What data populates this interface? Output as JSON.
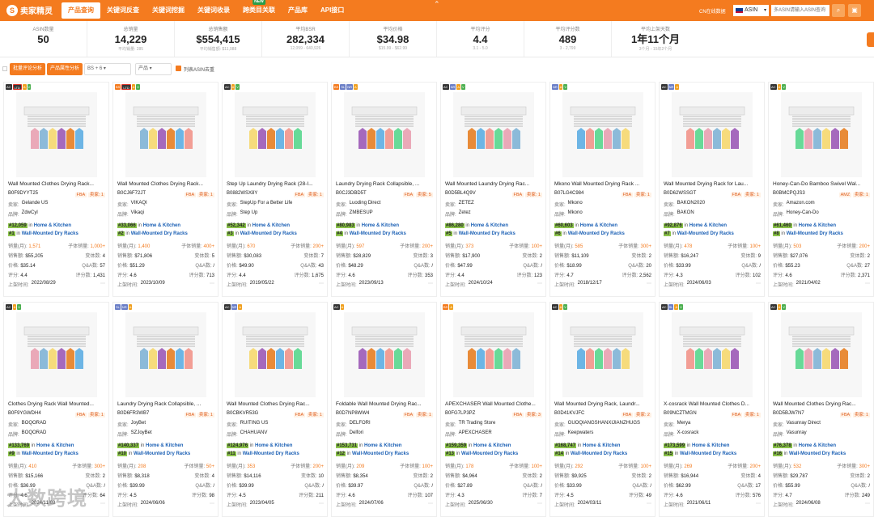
{
  "app": {
    "logo_text": "卖家精灵",
    "status_text": "CN在线数据",
    "marketplace": "ASIN",
    "search_placeholder": "多ASIN请输入ASIN查询"
  },
  "colors": {
    "brand": "#f47b1f",
    "rank_highlight": "#8bc34a",
    "link": "#1a5fb4"
  },
  "nav": [
    {
      "label": "产品查询",
      "active": true
    },
    {
      "label": "关键词反查"
    },
    {
      "label": "关键词挖掘"
    },
    {
      "label": "关键词收录"
    },
    {
      "label": "跨类目关联",
      "badge": "NEW"
    },
    {
      "label": "产品库"
    },
    {
      "label": "API接口"
    }
  ],
  "stats": [
    {
      "label": "ASIN数量",
      "value": "50",
      "sub": ""
    },
    {
      "label": "总销量",
      "value": "14,229",
      "sub": "平均销量: 285"
    },
    {
      "label": "总销售额",
      "value": "$554,415",
      "sub": "平均销售额: $11,088"
    },
    {
      "label": "平均BSR",
      "value": "282,334",
      "sub": "12,059 - 640,926"
    },
    {
      "label": "平均价格",
      "value": "$34.98",
      "sub": "$15.99 - $62.99"
    },
    {
      "label": "平均评分",
      "value": "4.4",
      "sub": "3.1 - 5.0"
    },
    {
      "label": "平均评分数",
      "value": "489",
      "sub": "3 - 2,799"
    },
    {
      "label": "平均上架天数",
      "value": "1年11个月",
      "sub": "3个月 - 15年2个月"
    }
  ],
  "toolbar": {
    "btn1": "批量评论分析",
    "btn2": "产品属性分析",
    "select1": "BS",
    "select1_extra": "+ 6",
    "select2": "产品",
    "checkbox_label": "列表ASIN去重"
  },
  "labels": {
    "seller": "卖家:",
    "brand": "品牌:",
    "sales": "销量(月):",
    "child_sales": "子体销量:",
    "revenue": "销售额:",
    "variants": "变体数:",
    "price": "价格:",
    "qa": "Q&A数:",
    "rating": "评分:",
    "reviews": "评分数:",
    "listed": "上架时间:",
    "in": "in",
    "cat_main": "Home & Kitchen",
    "cat_sub": "Wall-Mounted Dry Racks"
  },
  "products": [
    {
      "badges": [
        "AC",
        "LTD",
        "A",
        "V"
      ],
      "title": "Wall Mounted Clothes Drying Rack...",
      "asin": "B0F9DYYT25",
      "fulfil": "FBA",
      "variants_badge": "卖家: 1",
      "seller": "Gelande US",
      "brand": "ZdwCyl",
      "rank_main": "#12,059",
      "rank_sub": "#1",
      "sales": "1,571",
      "child_sales": "1,000+",
      "revenue": "$55,205",
      "variants": "4",
      "price": "$35.14",
      "qa": "57",
      "rating": "4.4",
      "reviews": "1,431",
      "listed": "2022/08/29"
    },
    {
      "badges": [
        "BS",
        "LTD",
        "A",
        "V"
      ],
      "title": "Wall Mounted Clothes Drying Rack...",
      "asin": "B0CJ6F72JT",
      "fulfil": "FBA",
      "variants_badge": "卖家: 1",
      "seller": "VIKAQI",
      "brand": "Vikaqi",
      "rank_main": "#33,066",
      "rank_sub": "#2",
      "sales": "1,400",
      "child_sales": "400+",
      "revenue": "$71,806",
      "variants": "5",
      "price": "$51.29",
      "qa": "/",
      "rating": "4.6",
      "reviews": "713",
      "listed": "2023/10/09"
    },
    {
      "badges": [
        "AC",
        "A",
        "V"
      ],
      "title": "Step Up Laundry Drying Rack (28-I...",
      "asin": "B0882WSX8Y",
      "fulfil": "FBA",
      "variants_badge": "卖家: 1",
      "seller": "StepUp For a Better Life",
      "brand": "Step Up",
      "rank_main": "#52,342",
      "rank_sub": "#3",
      "sales": "670",
      "child_sales": "200+",
      "revenue": "$30,083",
      "variants": "7",
      "price": "$49.90",
      "qa": "43",
      "rating": "4.4",
      "reviews": "1,675",
      "listed": "2019/05/22"
    },
    {
      "badges": [
        "BS",
        "SL",
        "NR",
        "A"
      ],
      "title": "Laundry Drying Rack Collapsible, ...",
      "asin": "B0CJ3DBD5T",
      "fulfil": "FBA",
      "variants_badge": "卖家: 5",
      "seller": "Luoding Direct",
      "brand": "ZMBESUP",
      "rank_main": "#80,983",
      "rank_sub": "#4",
      "sales": "597",
      "child_sales": "200+",
      "revenue": "$28,829",
      "variants": "3",
      "price": "$48.29",
      "qa": "/",
      "rating": "4.6",
      "reviews": "353",
      "listed": "2023/09/13"
    },
    {
      "badges": [
        "AC",
        "NR",
        "A",
        "V"
      ],
      "title": "Wall Mounted Laundry Drying Rac...",
      "asin": "B0D5BL4Q9V",
      "fulfil": "FBA",
      "variants_badge": "卖家: 1",
      "seller": "ZETEZ",
      "brand": "Zetez",
      "rank_main": "#86,280",
      "rank_sub": "#5",
      "sales": "373",
      "child_sales": "100+",
      "revenue": "$17,900",
      "variants": "2",
      "price": "$47.99",
      "qa": "/",
      "rating": "4.4",
      "reviews": "123",
      "listed": "2024/10/24"
    },
    {
      "badges": [
        "NR",
        "A",
        "V"
      ],
      "title": "Mkono Wall Mounted Drying Rack ...",
      "asin": "B07LG4C984",
      "fulfil": "FBA",
      "variants_badge": "卖家: 1",
      "seller": "Mkono",
      "brand": "Mkono",
      "rank_main": "#60,603",
      "rank_sub": "#6",
      "sales": "585",
      "child_sales": "300+",
      "revenue": "$11,109",
      "variants": "2",
      "price": "$18.99",
      "qa": "20",
      "rating": "4.7",
      "reviews": "2,562",
      "listed": "2018/12/17"
    },
    {
      "badges": [
        "AC",
        "NR",
        "A"
      ],
      "title": "Wall Mounted Drying Rack for Lau...",
      "asin": "B0D62WSSGT",
      "fulfil": "FBA",
      "variants_badge": "卖家: 1",
      "seller": "BAKON2020",
      "brand": "BAKON",
      "rank_main": "#92,876",
      "rank_sub": "#7",
      "sales": "478",
      "child_sales": "100+",
      "revenue": "$16,247",
      "variants": "9",
      "price": "$33.99",
      "qa": "/",
      "rating": "4.3",
      "reviews": "102",
      "listed": "2024/06/03"
    },
    {
      "badges": [
        "AC",
        "A",
        "V"
      ],
      "title": "Honey-Can-Do Bamboo Swivel Wal...",
      "asin": "B0BMCPQJS3",
      "fulfil": "AMZ",
      "variants_badge": "卖家: 1",
      "seller": "Amazon.com",
      "brand": "Honey-Can-Do",
      "rank_main": "#61,460",
      "rank_sub": "#8",
      "sales": "503",
      "child_sales": "200+",
      "revenue": "$27,076",
      "variants": "2",
      "price": "$55.23",
      "qa": "27",
      "rating": "4.6",
      "reviews": "2,371",
      "listed": "2021/04/02"
    },
    {
      "badges": [
        "AC",
        "A",
        "V"
      ],
      "title": "Clothes Drying Rack Wall Mounted...",
      "asin": "B0F9YGWDH4",
      "fulfil": "FBA",
      "variants_badge": "卖家: 1",
      "seller": "BOQORAD",
      "brand": "BOQORAD",
      "rank_main": "#133,769",
      "rank_sub": "#9",
      "sales": "410",
      "child_sales": "300+",
      "revenue": "$15,166",
      "variants": "2",
      "price": "$36.99",
      "qa": "/",
      "rating": "4.6",
      "reviews": "64",
      "listed": "2024/11/03"
    },
    {
      "badges": [
        "SL",
        "NR",
        "A"
      ],
      "title": "Laundry Drying Rack Collapsible, ...",
      "asin": "B0D6FR3WB7",
      "fulfil": "FBA",
      "variants_badge": "卖家: 1",
      "seller": "JoyBet",
      "brand": "SZJoyBet",
      "rank_main": "#140,337",
      "rank_sub": "#10",
      "sales": "208",
      "child_sales": "50+",
      "revenue": "$8,318",
      "variants": "4",
      "price": "$39.99",
      "qa": "/",
      "rating": "4.5",
      "reviews": "98",
      "listed": "2024/06/06"
    },
    {
      "badges": [
        "AC",
        "NR",
        "A"
      ],
      "title": "Wall Mounted Clothes Drying Rac...",
      "asin": "B0CBKVR53G",
      "fulfil": "FBA",
      "variants_badge": "卖家: 1",
      "seller": "RUITING US",
      "brand": "CHAHUANV",
      "rank_main": "#124,976",
      "rank_sub": "#11",
      "sales": "353",
      "child_sales": "200+",
      "revenue": "$14,116",
      "variants": "10",
      "price": "$39.99",
      "qa": "/",
      "rating": "4.5",
      "reviews": "211",
      "listed": "2023/04/05"
    },
    {
      "badges": [
        "AC",
        "A"
      ],
      "title": "Foldable Wall Mounted Drying Rac...",
      "asin": "B0D7NP8WW4",
      "fulfil": "FBA",
      "variants_badge": "卖家: 1",
      "seller": "DELFORI",
      "brand": "Delfori",
      "rank_main": "#153,731",
      "rank_sub": "#12",
      "sales": "209",
      "child_sales": "100+",
      "revenue": "$8,354",
      "variants": "2",
      "price": "$39.97",
      "qa": "/",
      "rating": "4.6",
      "reviews": "107",
      "listed": "2024/07/06"
    },
    {
      "badges": [
        "BS",
        "A"
      ],
      "title": "APEXCHASER Wall Mounted Clothe...",
      "asin": "B0FG7LP3PZ",
      "fulfil": "FBA",
      "variants_badge": "卖家: 3",
      "seller": "TR Trading Store",
      "brand": "APEXCHASER",
      "rank_main": "#159,359",
      "rank_sub": "#13",
      "sales": "178",
      "child_sales": "100+",
      "revenue": "$4,964",
      "variants": "2",
      "price": "$27.89",
      "qa": "/",
      "rating": "4.3",
      "reviews": "7",
      "listed": "2025/06/30"
    },
    {
      "badges": [
        "AC",
        "A",
        "V"
      ],
      "title": "Wall Mounted Drying Rack, Laundr...",
      "asin": "B0D41KVJFC",
      "fulfil": "FBA",
      "variants_badge": "卖家: 2",
      "seller": "GUOQIANGSHANXIJIANZHUGS",
      "brand": "Keepwaters",
      "rank_main": "#168,747",
      "rank_sub": "#14",
      "sales": "292",
      "child_sales": "100+",
      "revenue": "$9,925",
      "variants": "2",
      "price": "$33.99",
      "qa": "/",
      "rating": "4.5",
      "reviews": "49",
      "listed": "2024/03/11"
    },
    {
      "badges": [
        "AC",
        "SL",
        "A",
        "V"
      ],
      "title": "X-cosrack Wall Mounted Clothes D...",
      "asin": "B09NCZTMGN",
      "fulfil": "FBA",
      "variants_badge": "卖家: 1",
      "seller": "Merya",
      "brand": "X-cosrack",
      "rank_main": "#173,599",
      "rank_sub": "#15",
      "sales": "269",
      "child_sales": "200+",
      "revenue": "$16,944",
      "variants": "4",
      "price": "$62.99",
      "qa": "17",
      "rating": "4.6",
      "reviews": "576",
      "listed": "2021/06/11"
    },
    {
      "badges": [
        "AC",
        "A",
        "V"
      ],
      "title": "Wall Mounted Clothes Drying Rac...",
      "asin": "B0D5BJW7N7",
      "fulfil": "FBA",
      "variants_badge": "卖家: 1",
      "seller": "Vasunray Direct",
      "brand": "Vasunray",
      "rank_main": "#76,378",
      "rank_sub": "#16",
      "sales": "532",
      "child_sales": "300+",
      "revenue": "$29,787",
      "variants": "2",
      "price": "$55.99",
      "qa": "/",
      "rating": "4.7",
      "reviews": "249",
      "listed": "2024/06/08"
    }
  ],
  "watermark": "大数跨境"
}
